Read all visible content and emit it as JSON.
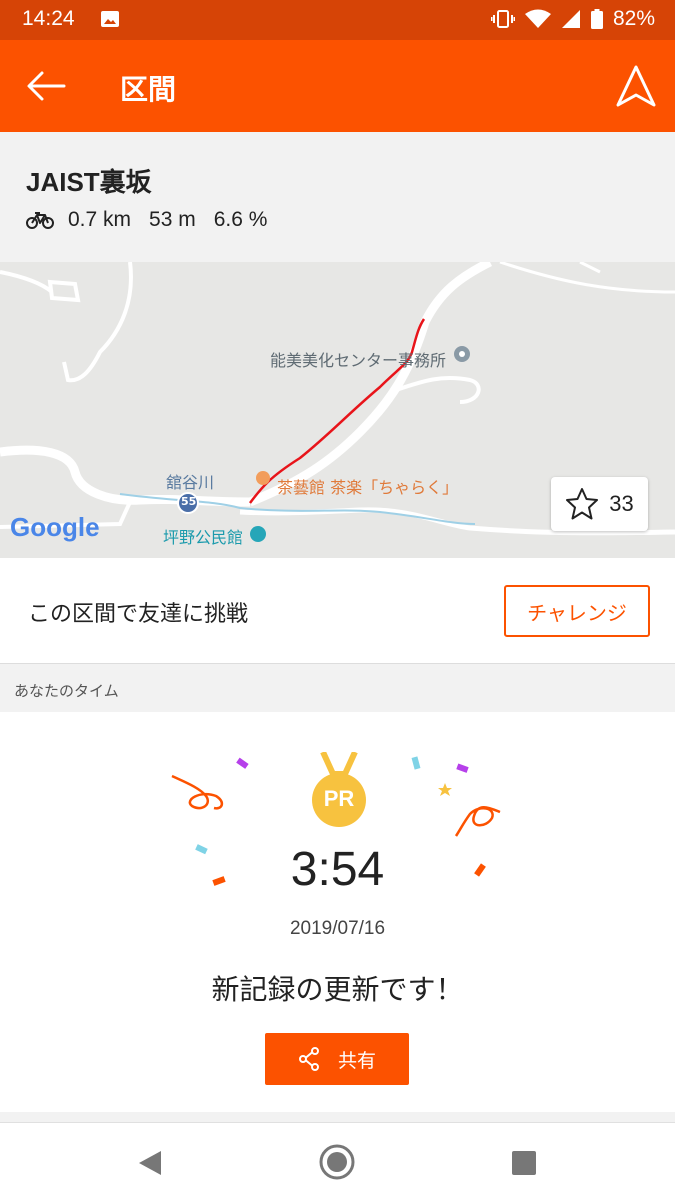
{
  "status": {
    "time": "14:24",
    "battery": "82%"
  },
  "appbar": {
    "title": "区間"
  },
  "segment": {
    "name": "JAIST裏坂",
    "distance": "0.7 km",
    "elevation": "53 m",
    "grade": "6.6 %"
  },
  "map": {
    "labels": {
      "poi1": "能美美化センター事務所",
      "river": "舘谷川",
      "road": "55",
      "poi2": "茶藝館 茶楽「ちゃらく」",
      "poi3": "坪野公民館",
      "google": "Google"
    },
    "star_count": "33"
  },
  "challenge": {
    "text": "この区間で友達に挑戦",
    "button": "チャレンジ"
  },
  "your_time": {
    "label": "あなたのタイム"
  },
  "result": {
    "medal": "PR",
    "time": "3:54",
    "date": "2019/07/16",
    "message": "新記録の更新です！",
    "share_label": "共有"
  },
  "colors": {
    "brand": "#fc5200",
    "statusbar": "#d64406",
    "medal": "#f7c23f",
    "route": "#e8141a"
  }
}
